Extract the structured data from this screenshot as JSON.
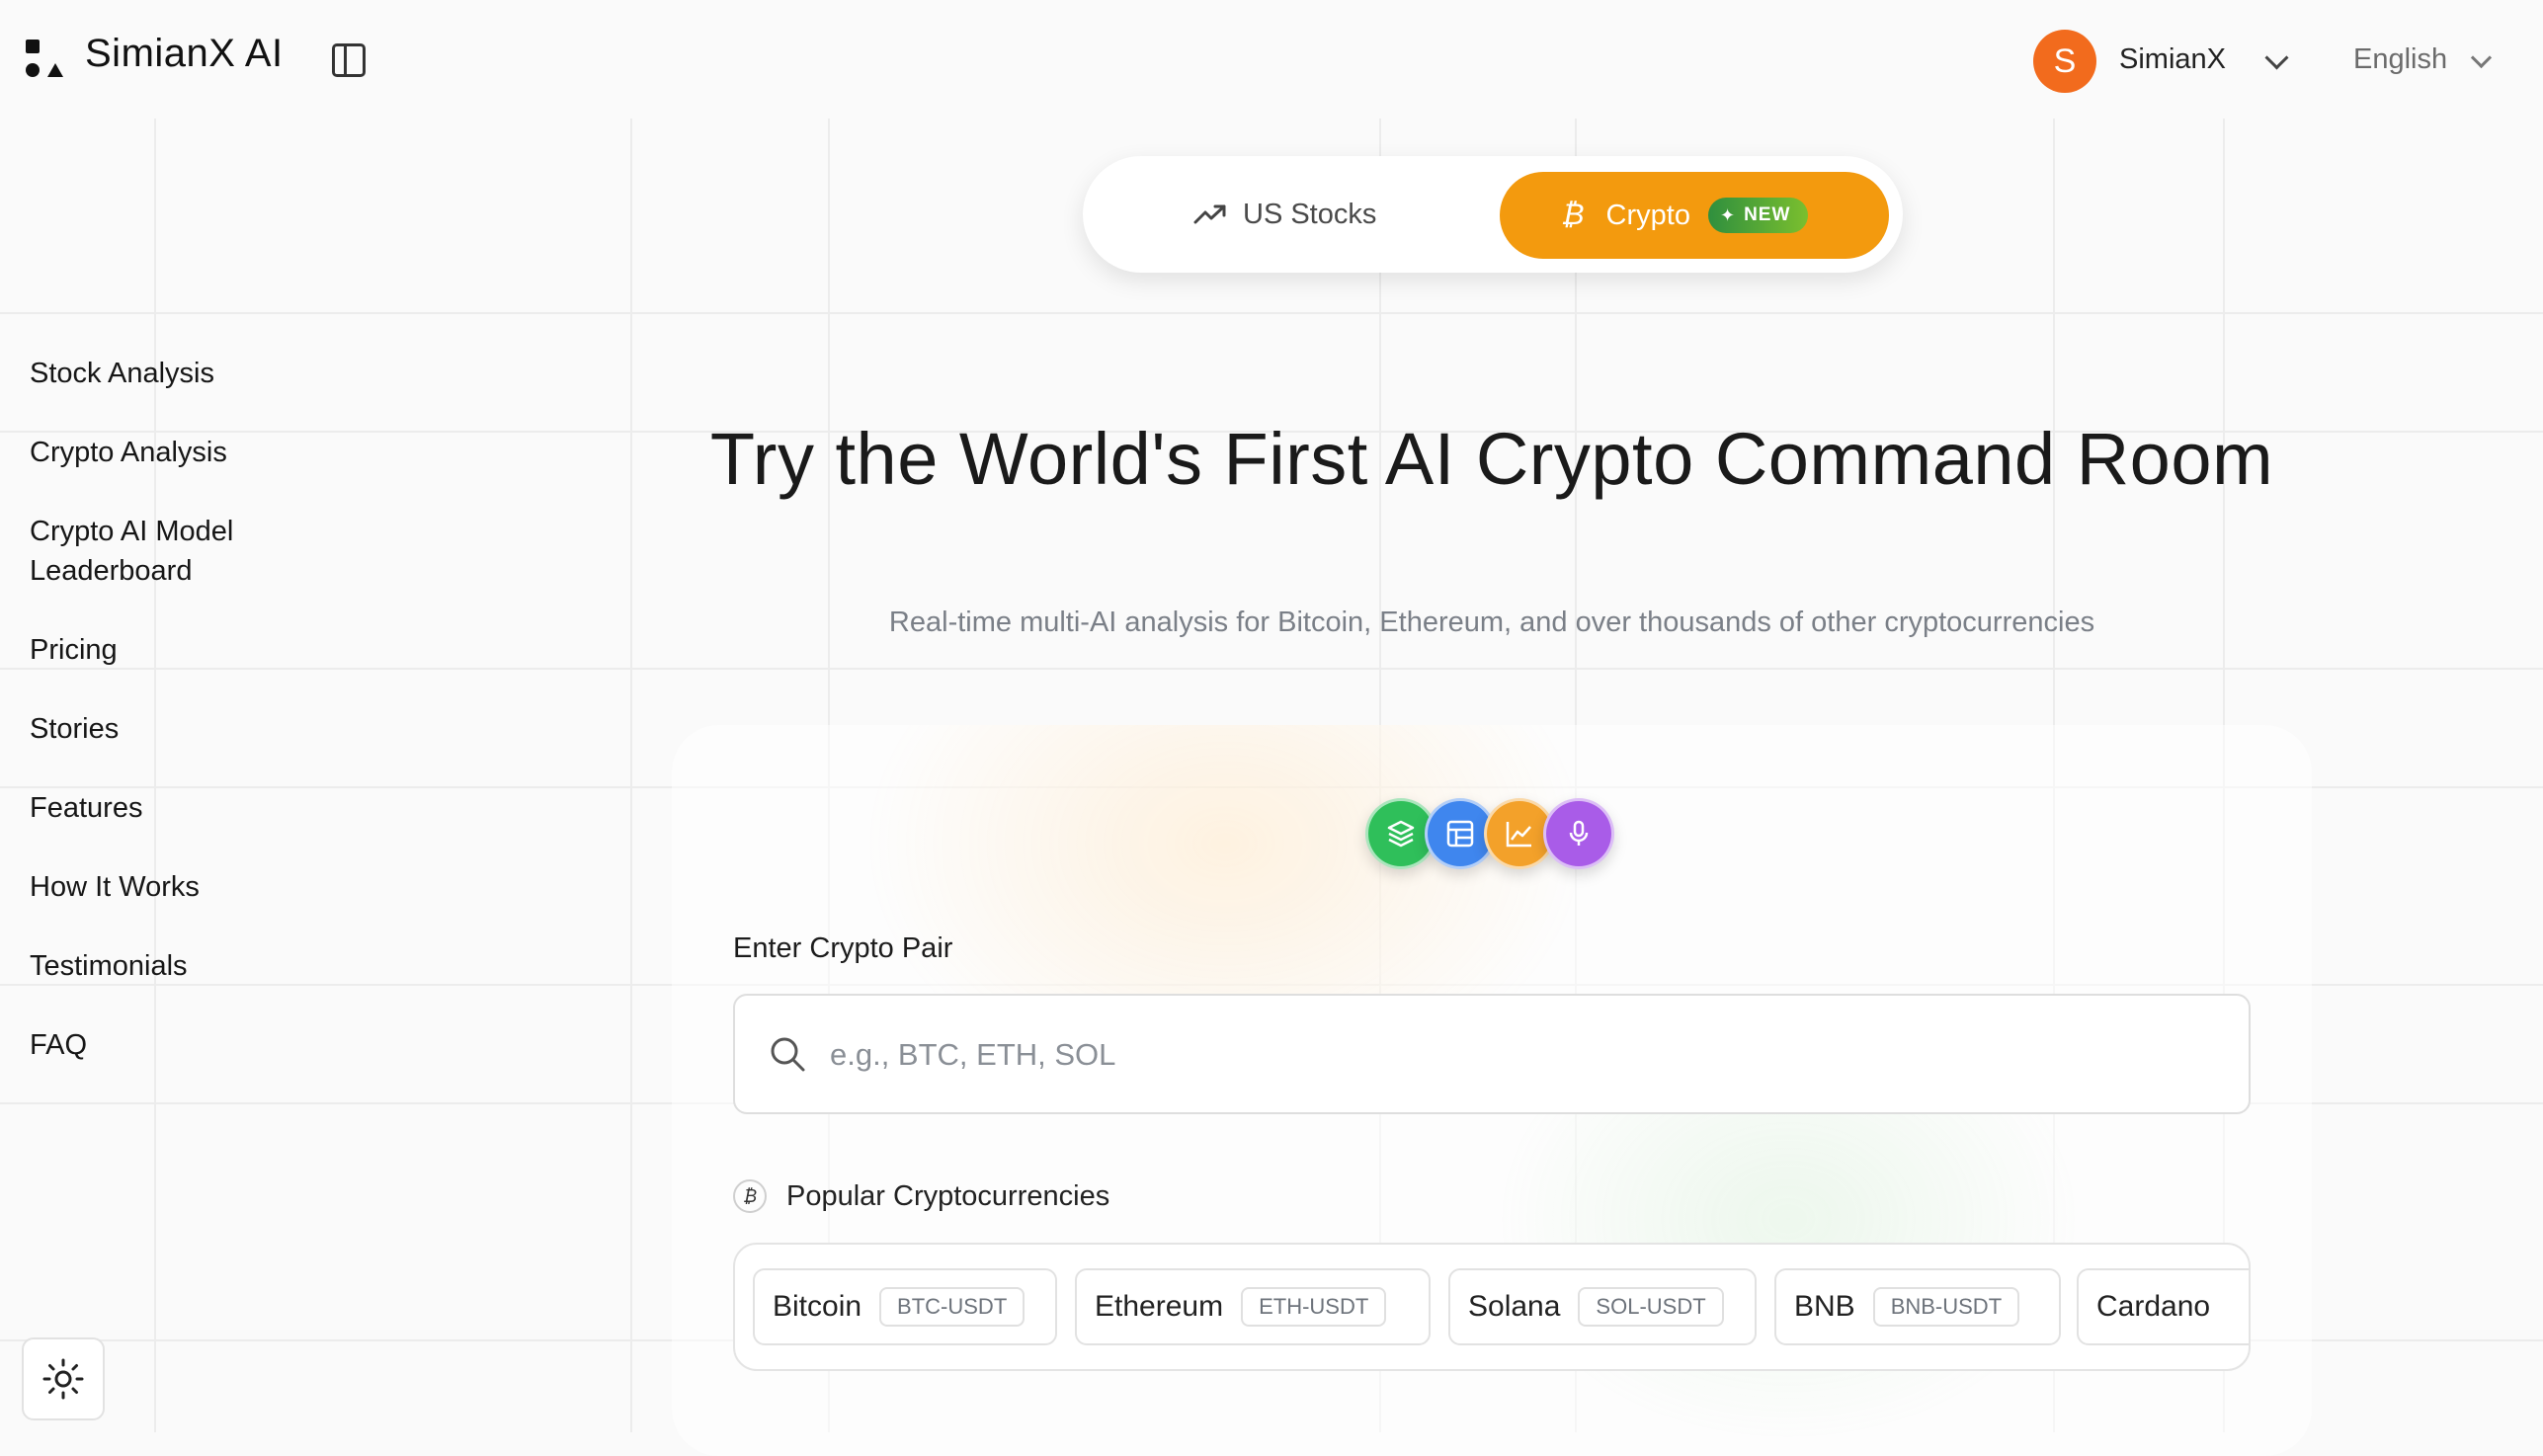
{
  "header": {
    "brand": "SimianX AI",
    "user": {
      "initial": "S",
      "name": "SimianX"
    },
    "language": "English"
  },
  "market_switch": {
    "stocks_label": "US Stocks",
    "crypto_label": "Crypto",
    "crypto_badge": "NEW",
    "active": "Crypto"
  },
  "sidebar": {
    "items": [
      {
        "label": "Stock Analysis"
      },
      {
        "label": "Crypto Analysis"
      },
      {
        "label": "Crypto AI Model Leaderboard"
      },
      {
        "label": "Pricing"
      },
      {
        "label": "Stories"
      },
      {
        "label": "Features"
      },
      {
        "label": "How It Works"
      },
      {
        "label": "Testimonials"
      },
      {
        "label": "FAQ"
      }
    ]
  },
  "hero": {
    "title": "Try the World's First AI Crypto Command Room",
    "subtitle": "Real-time multi-AI analysis for Bitcoin, Ethereum, and over thousands of other cryptocurrencies"
  },
  "tools": [
    {
      "icon": "layers-icon",
      "color": "#22c55e"
    },
    {
      "icon": "layout-icon",
      "color": "#3b82f6"
    },
    {
      "icon": "chart-icon",
      "color": "#f59e0b"
    },
    {
      "icon": "microphone-icon",
      "color": "#a855f7"
    }
  ],
  "search": {
    "label": "Enter Crypto Pair",
    "placeholder": "e.g., BTC, ETH, SOL",
    "value": ""
  },
  "popular": {
    "heading": "Popular Cryptocurrencies",
    "coins": [
      {
        "name": "Bitcoin",
        "pair": "BTC-USDT"
      },
      {
        "name": "Ethereum",
        "pair": "ETH-USDT"
      },
      {
        "name": "Solana",
        "pair": "SOL-USDT"
      },
      {
        "name": "BNB",
        "pair": "BNB-USDT"
      },
      {
        "name": "Cardano",
        "pair": ""
      }
    ]
  },
  "colors": {
    "accent": "#f39a0e",
    "avatar": "#f26b1d",
    "badge": "#4caf50"
  }
}
